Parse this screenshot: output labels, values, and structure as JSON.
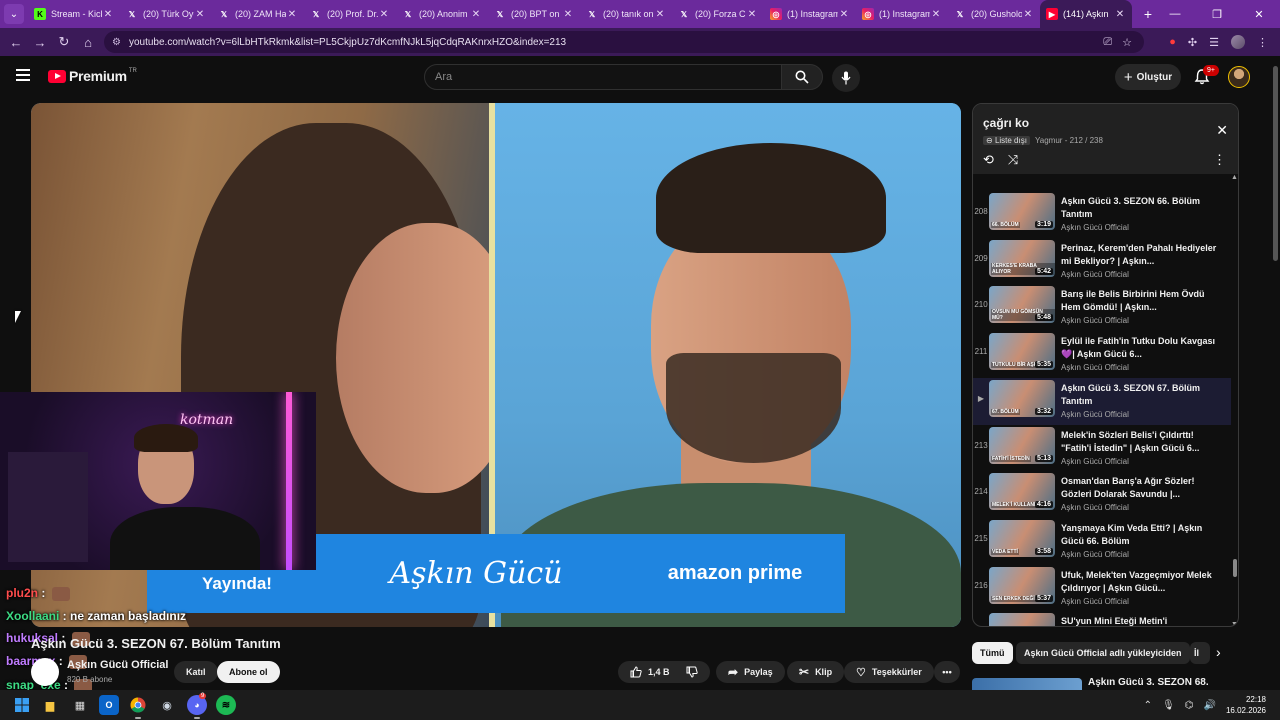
{
  "browser": {
    "tabs": [
      {
        "title": "Stream - Kick",
        "icon": "kick-icon",
        "active": false
      },
      {
        "title": "(20) Türk Oyun",
        "icon": "x-icon",
        "active": false
      },
      {
        "title": "(20) ZAM Ha",
        "icon": "x-icon",
        "active": false
      },
      {
        "title": "(20) Prof. Dr.",
        "icon": "x-icon",
        "active": false
      },
      {
        "title": "(20) Anonim",
        "icon": "x-icon",
        "active": false
      },
      {
        "title": "(20) BPT on",
        "icon": "x-icon",
        "active": false
      },
      {
        "title": "(20) tanık on",
        "icon": "x-icon",
        "active": false
      },
      {
        "title": "(20) Forza C",
        "icon": "x-icon",
        "active": false
      },
      {
        "title": "(1) Instagram",
        "icon": "instagram-icon",
        "active": false
      },
      {
        "title": "(1) Instagram",
        "icon": "instagram-icon",
        "active": false
      },
      {
        "title": "(20) Gusholo",
        "icon": "x-icon",
        "active": false
      },
      {
        "title": "(141) Aşkın",
        "icon": "youtube-icon",
        "active": true
      }
    ],
    "url": "youtube.com/watch?v=6lLbHTkRkmk&list=PL5CkjpUz7dKcmfNJkL5jqCdqRAKnrxHZO&index=213"
  },
  "youtube_header": {
    "logo_text": "Premium",
    "country_code": "TR",
    "search_placeholder": "Ara",
    "create_label": "Oluştur",
    "notification_count": "9+"
  },
  "video": {
    "banner_left": "Prime Video'da Yayında!",
    "banner_center": "Aşkın Gücü",
    "banner_right": "amazon prime",
    "title": "Aşkın Gücü 3. SEZON 67. Bölüm Tanıtım",
    "channel": "Aşkın Gücü Official",
    "subscribers": "820 B abone",
    "join_label": "Katıl",
    "subscribe_label": "Abone ol",
    "like_count": "1,4 B",
    "share_label": "Paylaş",
    "clip_label": "Klip",
    "thanks_label": "Teşekkürler"
  },
  "stream": {
    "neon_sign": "kotman",
    "chat": [
      {
        "user": "plu2n",
        "color": "#ff4d4d",
        "message": ""
      },
      {
        "user": "Xoollaani",
        "color": "#3ddc84",
        "message": "ne zaman başladınız"
      },
      {
        "user": "hukuksal",
        "color": "#c07cff",
        "message": ""
      },
      {
        "user": "baarmax",
        "color": "#c07cff",
        "message": ""
      },
      {
        "user": "snap_exe",
        "color": "#3ddc84",
        "message": ""
      }
    ]
  },
  "playlist": {
    "title": "çağrı ko",
    "visibility": "Liste dışı",
    "owner": "Yagmur",
    "position": "212 / 238",
    "items": [
      {
        "num": "208",
        "title": "Aşkın Gücü 3. SEZON 66. Bölüm Tanıtım",
        "channel": "Aşkın Gücü Official",
        "duration": "3:19",
        "caption": "66. BÖLÜM",
        "active": false
      },
      {
        "num": "209",
        "title": "Perinaz, Kerem'den Pahalı Hediyeler mi Bekliyor? | Aşkın...",
        "channel": "Aşkın Gücü Official",
        "duration": "5:42",
        "caption": "KERKES'E KRABA ALIYOR",
        "active": false
      },
      {
        "num": "210",
        "title": "Barış ile Belis Birbirini Hem Övdü Hem Gömdü! | Aşkın...",
        "channel": "Aşkın Gücü Official",
        "duration": "5:48",
        "caption": "OVSUN MU GÖMSÜN MÜ?",
        "active": false
      },
      {
        "num": "211",
        "title": "Eylül ile Fatih'in Tutku Dolu Kavgası 💜| Aşkın Gücü 6...",
        "channel": "Aşkın Gücü Official",
        "duration": "5:35",
        "caption": "TUTKULU BİR AŞK",
        "active": false
      },
      {
        "num": "▶",
        "title": "Aşkın Gücü 3. SEZON 67. Bölüm Tanıtım",
        "channel": "Aşkın Gücü Official",
        "duration": "3:32",
        "caption": "67. BÖLÜM",
        "active": true
      },
      {
        "num": "213",
        "title": "Melek'in Sözleri Belis'i Çıldırttı! \"Fatih'i İstedin\" | Aşkın Gücü 6...",
        "channel": "Aşkın Gücü Official",
        "duration": "5:13",
        "caption": "FATİH'İ İSTEDİN",
        "active": false
      },
      {
        "num": "214",
        "title": "Osman'dan Barış'a Ağır Sözler! Gözleri Dolarak Savundu |...",
        "channel": "Aşkın Gücü Official",
        "duration": "4:16",
        "caption": "MELEK'İ KULLANDIN",
        "active": false
      },
      {
        "num": "215",
        "title": "Yanşmaya Kim Veda Etti? | Aşkın Gücü 66. Bölüm",
        "channel": "Aşkın Gücü Official",
        "duration": "3:58",
        "caption": "VEDA ETTİ",
        "active": false
      },
      {
        "num": "216",
        "title": "Ufuk, Melek'ten Vazgeçmiyor Melek Çıldırıyor | Aşkın Gücü...",
        "channel": "Aşkın Gücü Official",
        "duration": "5:37",
        "caption": "SEN ERKEK DEĞİLSİN",
        "active": false
      },
      {
        "num": "",
        "title": "SU'yun Mini Eteği Metin'i",
        "channel": "",
        "duration": "",
        "caption": "",
        "active": false
      }
    ]
  },
  "chips": {
    "all": "Tümü",
    "uploader": "Aşkın Gücü Official adlı yükleyiciden",
    "more": "İl"
  },
  "recommendation_peek": "Aşkın Gücü 3. SEZON 68.",
  "taskbar": {
    "time": "22:18",
    "date": "16.02.2026",
    "discord_badge": "9"
  }
}
